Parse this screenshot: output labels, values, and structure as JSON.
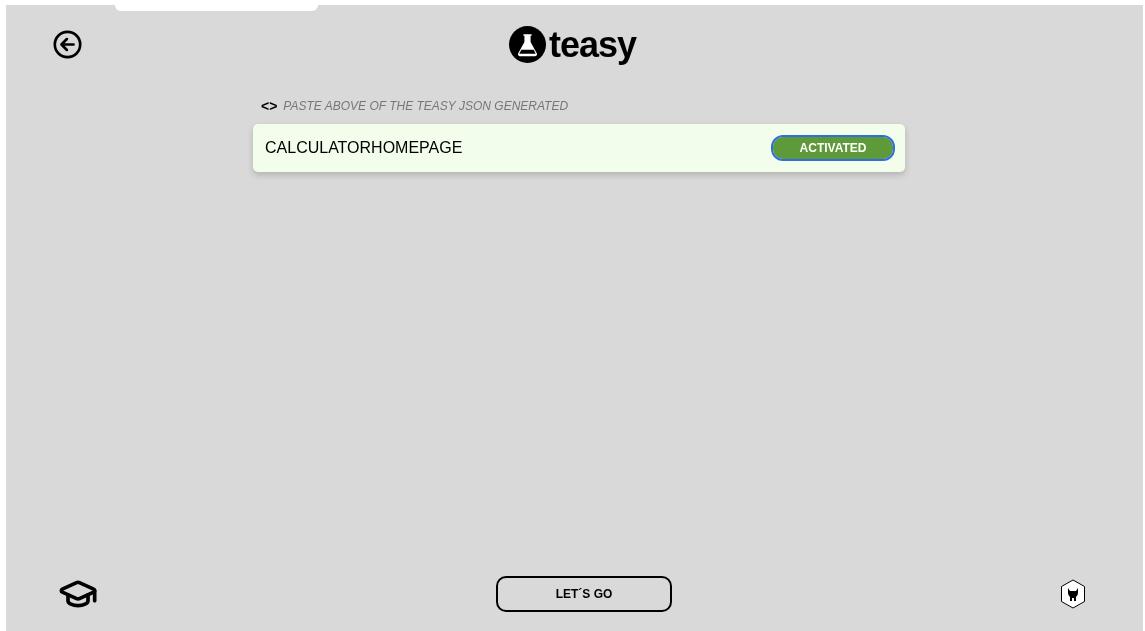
{
  "logo": {
    "text": "teasy"
  },
  "hint": {
    "icon": "<>",
    "text": "PASTE ABOVE OF THE TEASY JSON GENERATED"
  },
  "tests": [
    {
      "name": "CALCULATORHOMEPAGE",
      "status": "ACTIVATED",
      "activated": true,
      "focused": true
    }
  ],
  "footer": {
    "button": "LET´S GO"
  }
}
